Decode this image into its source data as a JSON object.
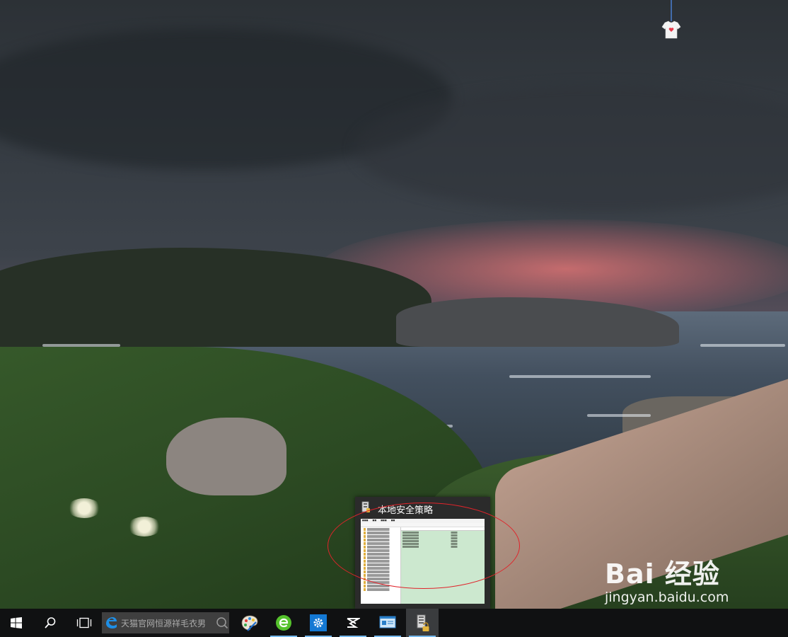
{
  "desktop": {
    "wallpaper": "coastal village at dusk under storm clouds",
    "watermark": {
      "logo": "Bai  经验",
      "url": "jingyan.baidu.com"
    }
  },
  "thumbnail": {
    "title": "本地安全策略",
    "icon": "local-security-policy-icon",
    "highlight_color": "#e0242b"
  },
  "taskbar": {
    "search_placeholder": "天猫官网恒源祥毛衣男",
    "accent": "#76b9ed",
    "items": [
      {
        "name": "start-button",
        "icon": "windows-logo-icon"
      },
      {
        "name": "search-button",
        "icon": "magnifier-icon"
      },
      {
        "name": "task-view-button",
        "icon": "task-view-icon"
      },
      {
        "name": "paint-app",
        "icon": "paint-palette-icon"
      },
      {
        "name": "browser-app",
        "icon": "green-e-browser-icon"
      },
      {
        "name": "settings-app",
        "icon": "gear-icon"
      },
      {
        "name": "capcut-app",
        "icon": "capcut-icon"
      },
      {
        "name": "control-panel-app",
        "icon": "control-panel-icon"
      },
      {
        "name": "local-security-policy-app",
        "icon": "security-policy-icon"
      }
    ]
  }
}
